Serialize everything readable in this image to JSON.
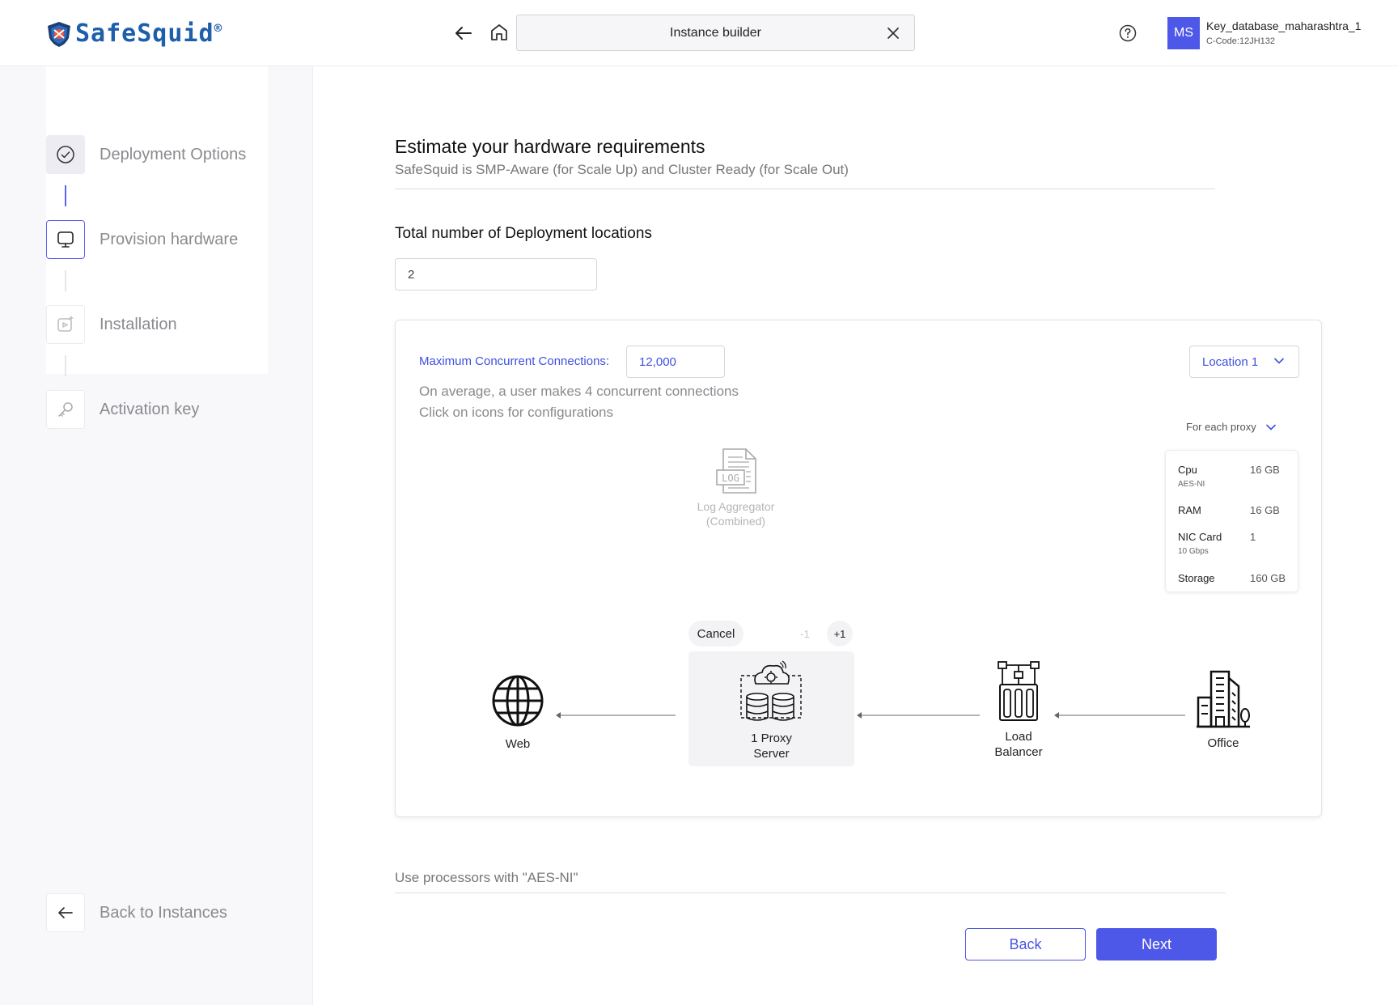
{
  "header": {
    "brand": "SafeSquid",
    "brand_mark": "®",
    "tab_label": "Instance builder",
    "avatar_initials": "MS",
    "user_name": "Key_database_maharashtra_1",
    "user_code": "C-Code:12JH132"
  },
  "sidebar": {
    "steps": [
      {
        "label": "Deployment Options",
        "icon": "check-circle-icon",
        "state": "done"
      },
      {
        "label": "Provision hardware",
        "icon": "monitor-icon",
        "state": "active"
      },
      {
        "label": "Installation",
        "icon": "play-sparkle-icon",
        "state": "pending"
      },
      {
        "label": "Activation key",
        "icon": "key-icon",
        "state": "pending"
      }
    ],
    "back_label": "Back to Instances"
  },
  "main": {
    "title": "Estimate your hardware requirements",
    "subtitle": "SafeSquid is SMP-Aware (for Scale Up) and Cluster Ready (for Scale Out)",
    "locations_title": "Total number of Deployment locations",
    "locations_value": "2",
    "card": {
      "mcc_label": "Maximum Concurrent Connections:",
      "mcc_value": "12,000",
      "avg_note": "On average, a user makes 4 concurrent connections",
      "click_note": "Click on icons for configurations",
      "location_select": "Location 1",
      "proxy_select": "For each proxy",
      "specs": [
        {
          "key": "Cpu",
          "sub": "AES-NI",
          "value": "16 GB"
        },
        {
          "key": "RAM",
          "sub": "",
          "value": "16 GB"
        },
        {
          "key": "NIC  Card",
          "sub": "10 Gbps",
          "value": "1"
        },
        {
          "key": "Storage",
          "sub": "",
          "value": "160 GB"
        }
      ],
      "log_label_1": "Log Aggregator",
      "log_label_2": "(Combined)",
      "log_icon_text": "LOG",
      "cancel": "Cancel",
      "minus": "-1",
      "plus": "+1",
      "web": "Web",
      "proxy_1": "1 Proxy",
      "proxy_2": "Server",
      "lb_1": "Load",
      "lb_2": "Balancer",
      "office": "Office"
    },
    "aes_note": "Use processors with \"AES-NI\"",
    "back_button": "Back",
    "next_button": "Next"
  },
  "colors": {
    "accent": "#4e58e8",
    "brand": "#1d5faa",
    "muted_text": "#8a8a8f"
  }
}
